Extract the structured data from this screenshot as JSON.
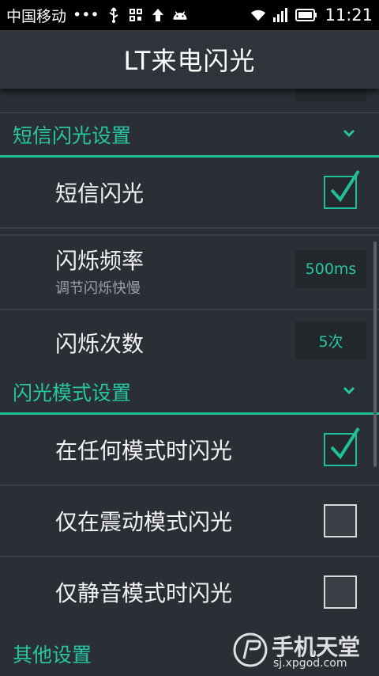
{
  "status_bar": {
    "carrier": "中国移动",
    "dots": "•••",
    "time": "11:21",
    "icons": [
      "usb-icon",
      "app-grid-icon",
      "upload-arrow-icon",
      "android-icon",
      "wifi-icon",
      "signal-icon",
      "battery-icon"
    ]
  },
  "app": {
    "title": "LT来电闪光"
  },
  "sections": {
    "sms": {
      "label": "短信闪光设置"
    },
    "mode": {
      "label": "闪光模式设置"
    },
    "other": {
      "label": "其他设置"
    }
  },
  "rows": {
    "sms_flash": {
      "label": "短信闪光",
      "checked": true
    },
    "blink_rate": {
      "label": "闪烁频率",
      "sub": "调节闪烁快慢",
      "value": "500ms"
    },
    "blink_count": {
      "label": "闪烁次数",
      "value": "5次"
    },
    "any_mode": {
      "label": "在任何模式时闪光",
      "checked": true
    },
    "vibrate_only": {
      "label": "仅在震动模式闪光",
      "checked": false
    },
    "silent_only": {
      "label": "仅静音模式时闪光",
      "checked": false
    }
  },
  "watermark": {
    "name": "手机天堂",
    "url": "sj.xpgod.com"
  },
  "colors": {
    "accent": "#1fbf9a",
    "background": "#2a2f35",
    "titlebar": "#2f343a"
  }
}
